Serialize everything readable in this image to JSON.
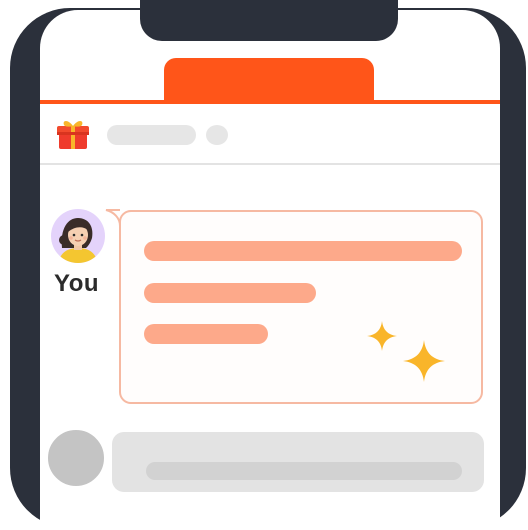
{
  "colors": {
    "frame": "#2b303b",
    "accent": "#ff5519",
    "message_line": "#fda98a",
    "message_border": "#f6b9a2",
    "sparkle": "#f9b52a",
    "skeleton": "#e6e6e6"
  },
  "header": {
    "gift_icon": "gift-icon"
  },
  "message": {
    "sender_label": "You",
    "avatar_icon": "woman-avatar-icon",
    "sparkle_icon": "sparkle-icon"
  }
}
